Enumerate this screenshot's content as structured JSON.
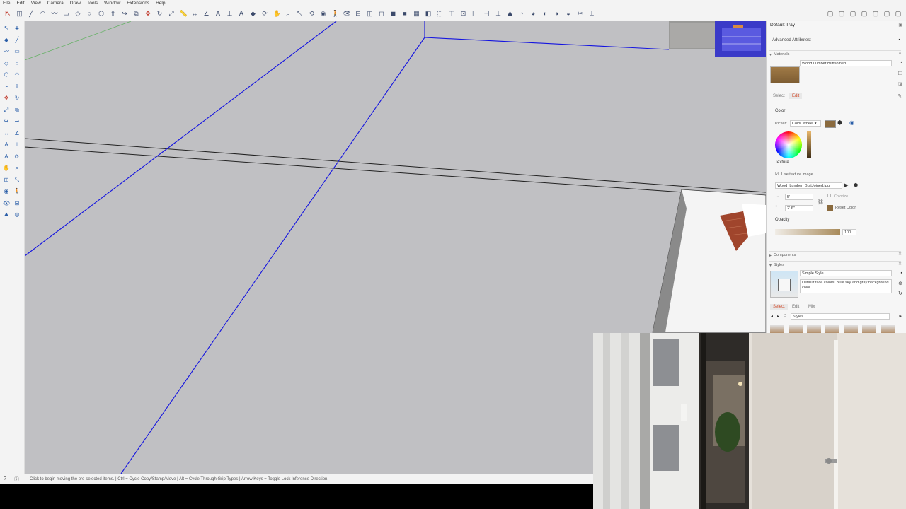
{
  "menu": [
    "File",
    "Edit",
    "View",
    "Camera",
    "Draw",
    "Tools",
    "Window",
    "Extensions",
    "Help"
  ],
  "toolbar": {
    "icons": [
      "select-tool-icon",
      "eraser-icon",
      "line-icon",
      "arc-icon",
      "freehand-icon",
      "rectangle-icon",
      "rotated-rectangle-icon",
      "circle-icon",
      "polygon-icon",
      "push-pull-icon",
      "follow-me-icon",
      "offset-icon",
      "move-icon",
      "rotate-icon",
      "scale-icon",
      "tape-measure-icon",
      "dimension-icon",
      "protractor-icon",
      "text-icon",
      "axes-icon",
      "3d-text-icon",
      "paint-bucket-icon",
      "orbit-icon",
      "pan-icon",
      "zoom-icon",
      "zoom-extents-icon",
      "previous-view-icon",
      "position-camera-icon",
      "walk-icon",
      "look-around-icon",
      "section-plane-icon",
      "xray-icon",
      "wireframe-icon",
      "hidden-line-icon",
      "shaded-icon",
      "textured-icon",
      "monochrome-icon",
      "iso-view-icon",
      "top-view-icon",
      "front-view-icon",
      "right-view-icon",
      "back-view-icon",
      "left-view-icon",
      "sandbox-icon",
      "solid-tools-icon",
      "outer-shell-icon",
      "intersect-icon",
      "union-icon",
      "subtract-icon",
      "trim-icon",
      "split-icon"
    ],
    "right_icons": [
      "styles-icon",
      "materials-icon",
      "components-icon",
      "layers-icon",
      "outliner-icon",
      "entity-info-icon",
      "scenes-icon"
    ]
  },
  "statusbar": {
    "text": "Click to begin moving the pre-selected items. | Ctrl = Cycle Copy/Stamp/Move | Alt = Cycle Through Grip Types | Arrow Keys = Toggle Lock Inference Direction."
  },
  "tray": {
    "title": "Default Tray",
    "advanced_attributes": "Advanced Attributes:",
    "materials": {
      "header": "Materials",
      "name": "Wood Lumber ButtJoined",
      "tabs": [
        "Select",
        "Edit"
      ],
      "active_tab": "Edit",
      "color_label": "Color",
      "picker_label": "Picker:",
      "picker_value": "Color Wheel",
      "texture_label": "Texture",
      "use_texture_label": "Use texture image",
      "texture_file": "Wood_Lumber_ButtJoined.jpg",
      "width_value": "5'",
      "height_value": "2' 6\"",
      "colorize_label": "Colorize",
      "reset_color_label": "Reset Color",
      "opacity_label": "Opacity",
      "opacity_value": "100",
      "swatch_color": "#8a6a3e"
    },
    "components_header": "Components",
    "styles": {
      "header": "Styles",
      "name": "Simple Style",
      "description": "Default face colors. Blue sky and gray background color.",
      "tabs": [
        "Select",
        "Edit",
        "Mix"
      ],
      "active_tab": "Select",
      "collection": "Styles"
    }
  },
  "colors": {
    "viewport_bg": "#c0c0c3",
    "selection_blue": "#1414e0",
    "accent": "#d04a2a"
  }
}
